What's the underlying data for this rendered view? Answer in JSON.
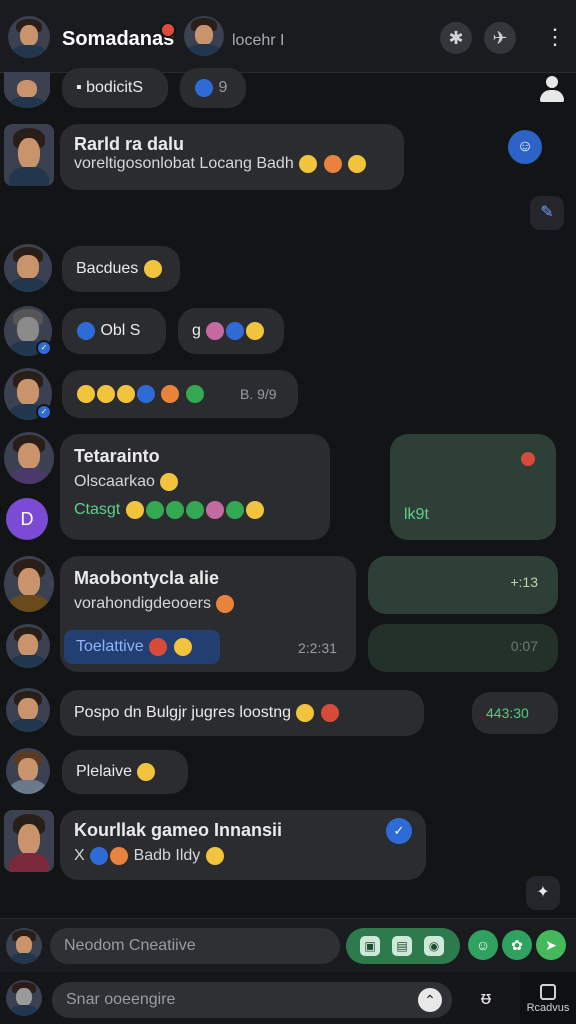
{
  "header": {
    "title": "Somadanas",
    "subtitle": "locehr I"
  },
  "messages": [
    {
      "text": "bodicitS",
      "extra": "9"
    },
    {
      "name": "Rarld ra dalu",
      "text": "voreltigosonlobat Locang Badh"
    },
    {
      "text": "Bacdues"
    },
    {
      "text": "Obl S",
      "extra": "g"
    },
    {
      "time": "B. 9/9"
    },
    {
      "name": "Tetarainto",
      "text": "Olscaarkao",
      "third": "Ctasgt"
    },
    {
      "name": "Maobontycla alie",
      "text": "vorahondigdeooers",
      "highlight": "Toelattive",
      "time": "2:2:31"
    },
    {
      "text": "Pospo dn Bulgjr  jugres  loostng"
    },
    {
      "text": "Plelaive"
    },
    {
      "name": "Kourllak gameo Innansii",
      "text": "Badb  Ildy"
    }
  ],
  "right": {
    "kot": "lk9t",
    "time1": "+:13",
    "time2": "0:07",
    "time3": "443:30"
  },
  "composer": {
    "placeholder1": "Neodom Cneatiive",
    "placeholder2": "Snar ooeengire",
    "rest_label": "Rcadvus"
  }
}
